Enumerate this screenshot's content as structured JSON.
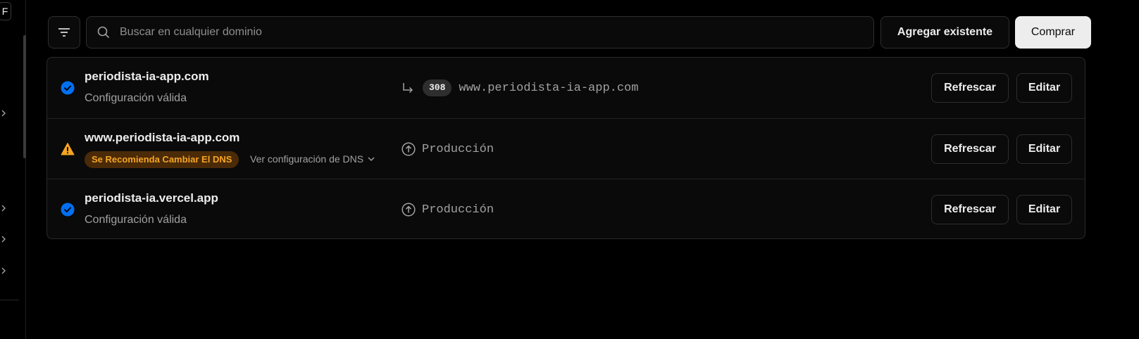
{
  "sidebar": {
    "shortcut_key": "F"
  },
  "toolbar": {
    "search_placeholder": "Buscar en cualquier dominio",
    "add_existing_label": "Agregar existente",
    "buy_label": "Comprar"
  },
  "domains": [
    {
      "name": "periodista-ia-app.com",
      "status": "valid",
      "status_text": "Configuración válida",
      "redirect_code": "308",
      "target": "www.periodista-ia-app.com",
      "refresh_label": "Refrescar",
      "edit_label": "Editar"
    },
    {
      "name": "www.periodista-ia-app.com",
      "status": "warning",
      "badge_text": "Se Recomienda Cambiar El DNS",
      "dns_toggle_text": "Ver configuración de DNS",
      "target": "Producción",
      "refresh_label": "Refrescar",
      "edit_label": "Editar"
    },
    {
      "name": "periodista-ia.vercel.app",
      "status": "valid",
      "status_text": "Configuración válida",
      "target": "Producción",
      "refresh_label": "Refrescar",
      "edit_label": "Editar"
    }
  ],
  "colors": {
    "background": "#000000",
    "valid_blue": "#0070f3",
    "warning_amber": "#f5a524",
    "badge_bg": "#4a2a07"
  },
  "icons": [
    "filter-icon",
    "search-icon",
    "check-circle-icon",
    "warning-triangle-icon",
    "redirect-arrow-icon",
    "arrow-up-circle-icon",
    "chevron-down-icon",
    "chevron-right-icon"
  ]
}
